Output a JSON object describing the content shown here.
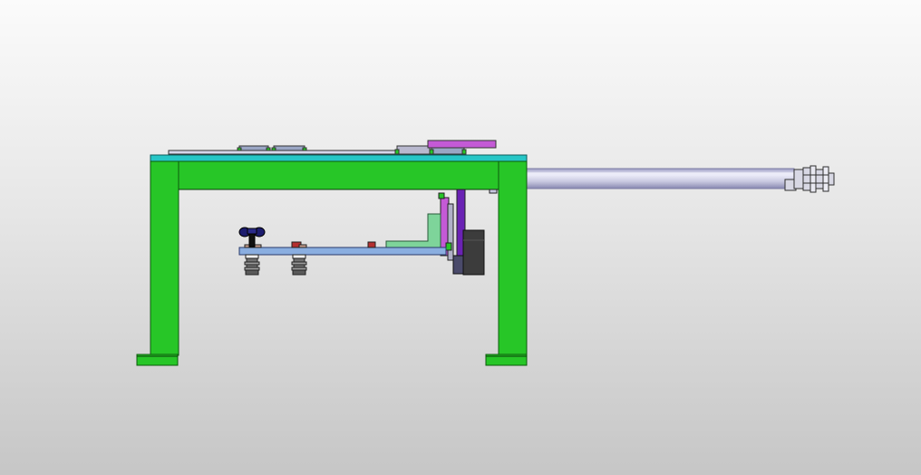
{
  "scene": {
    "view": "side elevation",
    "background": {
      "top": "#fbfbfb",
      "bottom": "#c6c6c6"
    },
    "colors": {
      "frame": "#27c627",
      "frame_edge": "#0e5a0e",
      "top_plate": "#26c6c6",
      "rod": "#c8c8e0",
      "rod_highlight": "#eeeefa",
      "plate": "#8aaee0",
      "bracket": "#7ed49a",
      "purple_block": "#c45ad6",
      "violet_bar": "#6a22b4",
      "motor": "#3c3c3c",
      "suction_cup": "#707070",
      "dark_blue": "#1c1c6e",
      "marker_red": "#b43030"
    },
    "parts": [
      "steel-frame",
      "top-plate",
      "linear-rod",
      "rod-end-fitting",
      "carriage-plate",
      "suction-cup",
      "vertical-slide",
      "motor-housing"
    ]
  }
}
